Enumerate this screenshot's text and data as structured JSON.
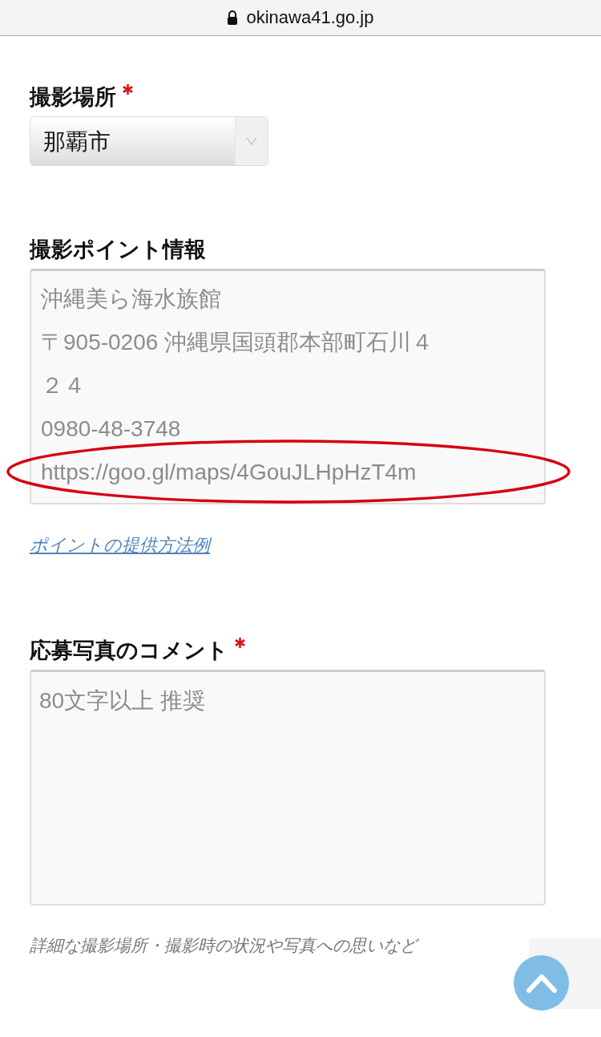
{
  "address_bar": {
    "url": "okinawa41.go.jp"
  },
  "fields": [
    {
      "kind": "select",
      "label": "撮影場所",
      "required": true,
      "value": "那覇市"
    },
    {
      "kind": "textarea",
      "label": "撮影ポイント情報",
      "required": false,
      "placeholder_lines": [
        "沖縄美ら海水族館",
        "〒905-0206 沖縄県国頭郡本部町石川４",
        "２４",
        "0980-48-3748",
        "https://goo.gl/maps/4GouJLHpHzT4m"
      ],
      "highlight_ellipse": true,
      "link": "ポイントの提供方法例"
    },
    {
      "kind": "textarea",
      "label": "応募写真のコメント",
      "required": true,
      "placeholder_lines": [
        "80文字以上 推奨"
      ],
      "highlight_ellipse": false,
      "hint": "詳細な撮影場所・撮影時の状況や写真への思いなど"
    }
  ]
}
